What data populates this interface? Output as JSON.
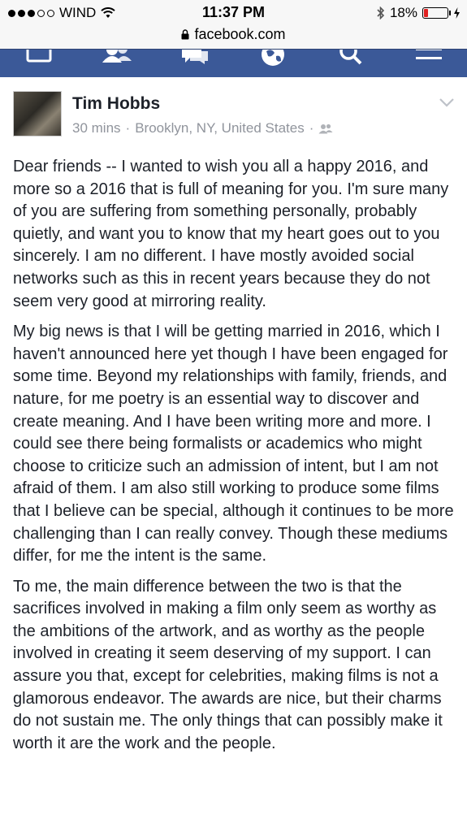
{
  "status_bar": {
    "carrier": "WIND",
    "time": "11:37 PM",
    "battery_percent": "18%",
    "battery_level": 0.18,
    "battery_color": "#e02020"
  },
  "browser": {
    "url": "facebook.com",
    "lock_icon": "lock-icon"
  },
  "nav": {
    "background": "#3b5998",
    "icons": [
      "home-icon",
      "friends-icon",
      "messages-icon",
      "globe-icon",
      "search-icon",
      "menu-icon"
    ]
  },
  "post": {
    "author": "Tim Hobbs",
    "time": "30 mins",
    "separator": "·",
    "location": "Brooklyn, NY, United States",
    "audience_icon": "friends-audience-icon",
    "paragraphs": [
      "Dear friends -- I wanted to wish you all a happy 2016, and more so a 2016 that is full of meaning for you. I'm sure many of you are suffering from something personally, probably quietly, and want you to know that my heart goes out to you sincerely. I am no different. I have mostly avoided social networks such as this in recent years because they do not seem very good at mirroring reality.",
      "My big news is that I will be getting married in 2016, which I haven't announced here yet though I have been engaged for some time. Beyond my relationships with family, friends, and nature, for me poetry is an essential way to discover and create meaning. And I have been writing more and more. I could see there being formalists or academics who might choose to criticize such an admission of intent, but I am not afraid of them. I am also still working to produce some films that I believe can be special, although it continues to be more challenging than I can really convey. Though these mediums differ, for me the intent is the same.",
      "To me, the main difference between the two is that the sacrifices involved in making a film only seem as worthy as the ambitions of the artwork, and as worthy as the people involved in creating it seem deserving of my support. I can assure you that, except for celebrities, making films is not a glamorous endeavor. The awards are nice, but their charms do not sustain me. The only things that can possibly make it worth it are the work and the people."
    ]
  }
}
